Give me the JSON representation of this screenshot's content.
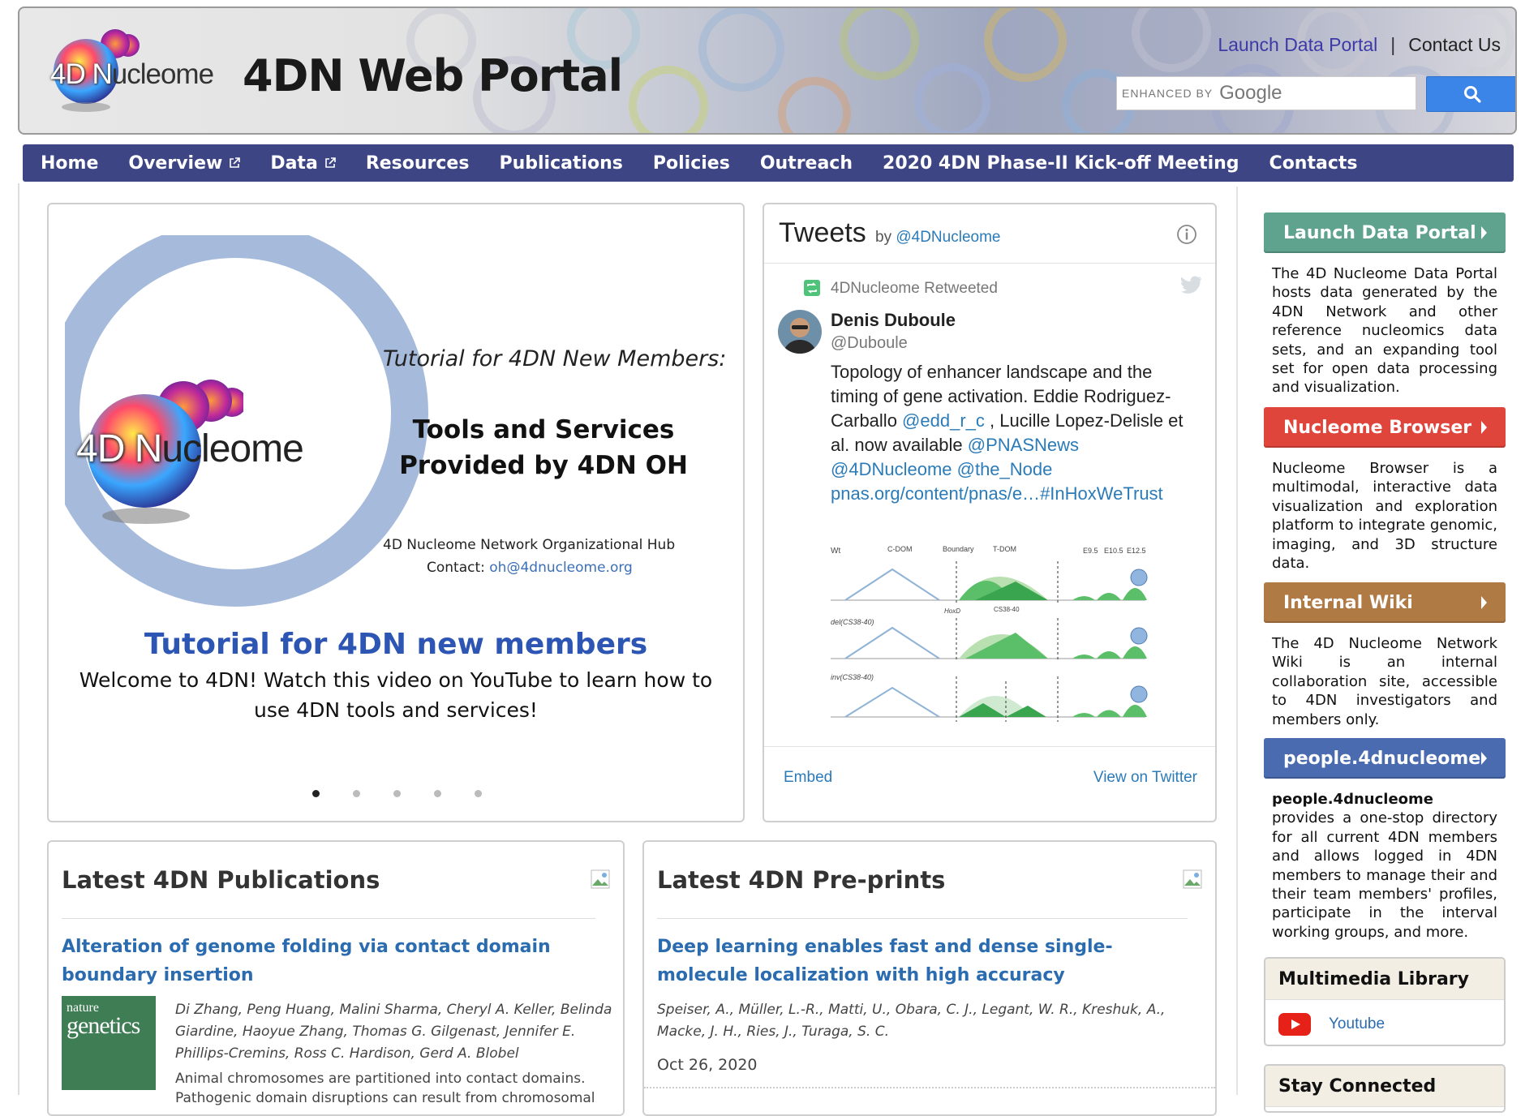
{
  "header": {
    "logo_prefix": "4D N",
    "logo_rest": "ucleome",
    "site_title": "4DN Web Portal",
    "top_links": {
      "launch": "Launch Data Portal",
      "separator": "|",
      "contact": "Contact Us"
    },
    "search": {
      "enhanced_by": "ENHANCED BY",
      "google": "Google",
      "button_icon": "search-icon"
    }
  },
  "nav": {
    "items": [
      {
        "label": "Home"
      },
      {
        "label": "Overview",
        "icon": "external-link-icon"
      },
      {
        "label": "Data",
        "icon": "external-link-icon"
      },
      {
        "label": "Resources"
      },
      {
        "label": "Publications"
      },
      {
        "label": "Policies"
      },
      {
        "label": "Outreach"
      },
      {
        "label": "2020 4DN Phase-II Kick-off Meeting"
      },
      {
        "label": "Contacts"
      }
    ]
  },
  "carousel": {
    "slide": {
      "logo_prefix": "4D N",
      "logo_rest": "ucleome",
      "heading": "Tutorial for 4DN New Members:",
      "sub_line1": "Tools and Services",
      "sub_line2": "Provided by 4DN OH",
      "hub": "4D Nucleome Network Organizational Hub",
      "contact_label": "Contact: ",
      "contact_email": "oh@4dnucleome.org"
    },
    "title": "Tutorial for 4DN new members",
    "description": "Welcome to 4DN! Watch this video on YouTube to learn how to use 4DN tools and services!",
    "dot_count": 5,
    "active_dot": 1
  },
  "tweets": {
    "title": "Tweets",
    "by": "by ",
    "handle": "@4DNucleome",
    "retweeted": "4DNucleome Retweeted",
    "author_name": "Denis Duboule",
    "author_handle": "@Duboule",
    "text_1": "Topology of enhancer landscape and the timing of gene activation. Eddie Rodriguez-Carballo ",
    "mention_1": "@edd_r_c",
    "text_2": " , Lucille Lopez-Delisle et al. now available ",
    "mention_2": "@PNASNews",
    "mention_3": "@4DNucleome",
    "mention_4": "@the_Node",
    "link": "pnas.org/content/pnas/e…",
    "hashtag": "#InHoxWeTrust",
    "figure": {
      "label_wt": "Wt",
      "label_cdom": "C-DOM",
      "label_boundary": "Boundary",
      "label_tdom": "T-DOM",
      "label_e95": "E9.5",
      "label_e105": "E10.5",
      "label_e125": "E12.5",
      "label_hoxd": "HoxD",
      "label_cs": "CS38-40",
      "label_del": "del(CS38-40)",
      "label_inv": "inv(CS38-40)"
    },
    "embed": "Embed",
    "view_on_twitter": "View on Twitter"
  },
  "publications": {
    "title": "Latest 4DN Publications",
    "item_title": "Alteration of genome folding via contact domain boundary insertion",
    "journal_line1": "nature",
    "journal_line2": "genetics",
    "authors": "Di Zhang, Peng Huang, Malini Sharma, Cheryl A. Keller, Belinda Giardine, Haoyue Zhang, Thomas G. Gilgenast, Jennifer E. Phillips-Cremins, Ross C. Hardison, Gerd A. Blobel",
    "abstract": "Animal chromosomes are partitioned into contact domains. Pathogenic domain disruptions can result from chromosomal"
  },
  "preprints": {
    "title": "Latest 4DN Pre-prints",
    "item_title": "Deep learning enables fast and dense single-molecule localization with high accuracy",
    "authors": "Speiser, A., Müller, L.-R., Matti, U., Obara, C. J., Legant, W. R., Kreshuk, A., Macke, J. H., Ries, J., Turaga, S. C.",
    "date": "Oct 26, 2020"
  },
  "sidebar": {
    "launch": {
      "label": "Launch Data Portal",
      "color": "#5fa38f",
      "desc": "The 4D Nucleome Data Portal hosts data generated by the 4DN Network and other reference nucleomics data sets, and an expanding tool set for open data processing and visualization."
    },
    "browser": {
      "label": "Nucleome Browser",
      "color": "#e0453c",
      "desc": "Nucleome Browser is a multimodal, interactive data visualization and exploration platform to integrate genomic, imaging, and 3D structure data."
    },
    "wiki": {
      "label": "Internal Wiki",
      "color": "#b07a45",
      "desc": "The 4D Nucleome Network Wiki is an internal collaboration site, accessible to 4DN investigators and members only."
    },
    "people": {
      "label": "people.4dnucleome",
      "color": "#4a6bb0",
      "desc_bold": "people.4dnucleome",
      "desc": " provides a one-stop directory for all current 4DN members and allows logged in 4DN members to manage their and their team members' profiles, participate in the interval working groups, and more."
    },
    "multimedia": {
      "title": "Multimedia Library",
      "youtube": "Youtube"
    },
    "stay_connected": {
      "title": "Stay Connected"
    }
  },
  "colors": {
    "nav_bg": "#3d4584",
    "link": "#2b6cb0",
    "twitter_blue": "#2b7bb9"
  }
}
